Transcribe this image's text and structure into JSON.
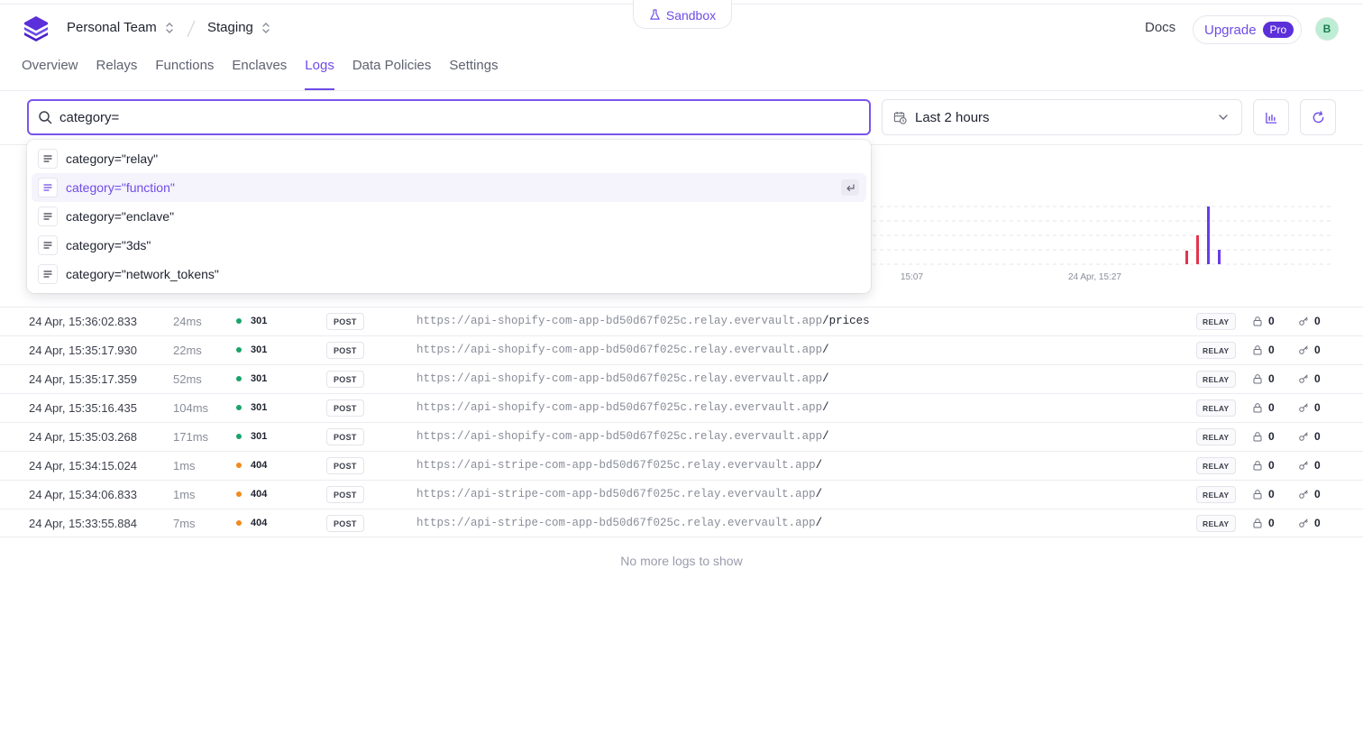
{
  "header": {
    "sandbox_label": "Sandbox",
    "team_name": "Personal Team",
    "environment": "Staging",
    "docs_label": "Docs",
    "upgrade_label": "Upgrade",
    "pro_badge": "Pro",
    "avatar_initial": "B"
  },
  "nav": {
    "tabs": [
      "Overview",
      "Relays",
      "Functions",
      "Enclaves",
      "Logs",
      "Data Policies",
      "Settings"
    ],
    "active": "Logs"
  },
  "search": {
    "value": "category=",
    "suggestions": [
      "category=\"relay\"",
      "category=\"function\"",
      "category=\"enclave\"",
      "category=\"3ds\"",
      "category=\"network_tokens\""
    ],
    "highlighted_index": 1
  },
  "time_range": {
    "label": "Last 2 hours"
  },
  "chart": {
    "tick_labels": [
      "15:07",
      "24 Apr, 15:27"
    ],
    "colors": {
      "error": "#e2344e",
      "success": "#6a3be8"
    }
  },
  "logs": {
    "rows": [
      {
        "time": "24 Apr, 15:36:02.833",
        "duration": "24ms",
        "status": "301",
        "method": "POST",
        "url_host": "https://api-shopify-com-app-bd50d67f025c.relay.evervault.app",
        "url_path": "/prices",
        "type": "RELAY",
        "encrypted": "0",
        "decrypted": "0"
      },
      {
        "time": "24 Apr, 15:35:17.930",
        "duration": "22ms",
        "status": "301",
        "method": "POST",
        "url_host": "https://api-shopify-com-app-bd50d67f025c.relay.evervault.app",
        "url_path": "/",
        "type": "RELAY",
        "encrypted": "0",
        "decrypted": "0"
      },
      {
        "time": "24 Apr, 15:35:17.359",
        "duration": "52ms",
        "status": "301",
        "method": "POST",
        "url_host": "https://api-shopify-com-app-bd50d67f025c.relay.evervault.app",
        "url_path": "/",
        "type": "RELAY",
        "encrypted": "0",
        "decrypted": "0"
      },
      {
        "time": "24 Apr, 15:35:16.435",
        "duration": "104ms",
        "status": "301",
        "method": "POST",
        "url_host": "https://api-shopify-com-app-bd50d67f025c.relay.evervault.app",
        "url_path": "/",
        "type": "RELAY",
        "encrypted": "0",
        "decrypted": "0"
      },
      {
        "time": "24 Apr, 15:35:03.268",
        "duration": "171ms",
        "status": "301",
        "method": "POST",
        "url_host": "https://api-shopify-com-app-bd50d67f025c.relay.evervault.app",
        "url_path": "/",
        "type": "RELAY",
        "encrypted": "0",
        "decrypted": "0"
      },
      {
        "time": "24 Apr, 15:34:15.024",
        "duration": "1ms",
        "status": "404",
        "method": "POST",
        "url_host": "https://api-stripe-com-app-bd50d67f025c.relay.evervault.app",
        "url_path": "/",
        "type": "RELAY",
        "encrypted": "0",
        "decrypted": "0"
      },
      {
        "time": "24 Apr, 15:34:06.833",
        "duration": "1ms",
        "status": "404",
        "method": "POST",
        "url_host": "https://api-stripe-com-app-bd50d67f025c.relay.evervault.app",
        "url_path": "/",
        "type": "RELAY",
        "encrypted": "0",
        "decrypted": "0"
      },
      {
        "time": "24 Apr, 15:33:55.884",
        "duration": "7ms",
        "status": "404",
        "method": "POST",
        "url_host": "https://api-stripe-com-app-bd50d67f025c.relay.evervault.app",
        "url_path": "/",
        "type": "RELAY",
        "encrypted": "0",
        "decrypted": "0"
      }
    ],
    "status_colors": {
      "301": "#1aa36b",
      "404": "#f08a1c"
    },
    "footer": "No more logs to show"
  },
  "theme": {
    "accent": "#6e4ce8"
  }
}
